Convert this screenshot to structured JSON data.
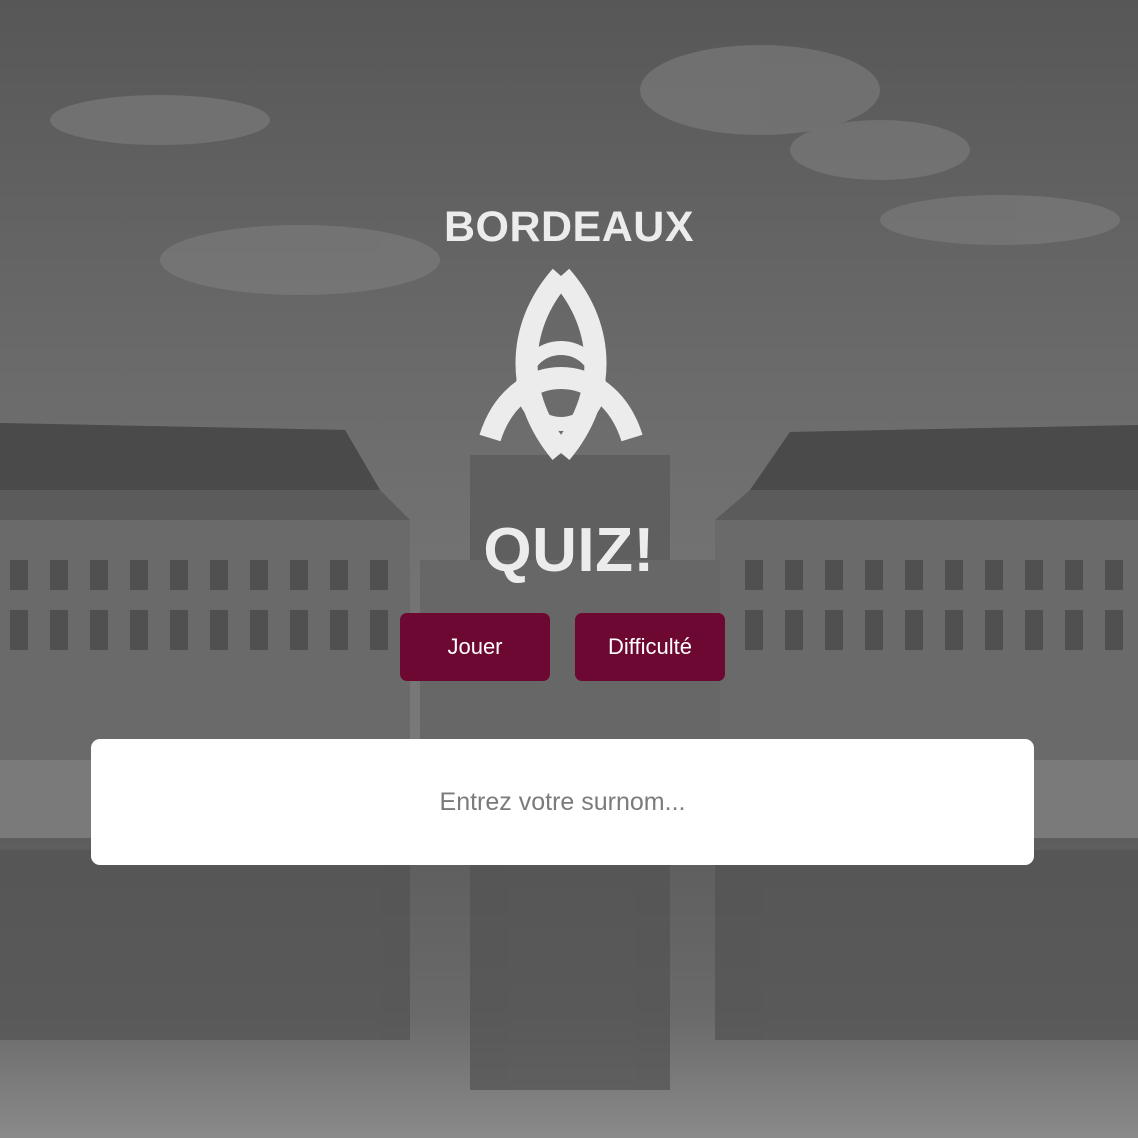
{
  "header": {
    "title_top": "BORDEAUX",
    "title_bottom": "QUIZ!"
  },
  "logo": {
    "icon": "triquetra-logo-icon"
  },
  "buttons": {
    "play_label": "Jouer",
    "difficulty_label": "Difficulté"
  },
  "nickname": {
    "placeholder": "Entrez votre surnom...",
    "value": ""
  },
  "colors": {
    "accent": "#6d0833",
    "title": "#ececec",
    "overlay": "#6e6e6e"
  }
}
